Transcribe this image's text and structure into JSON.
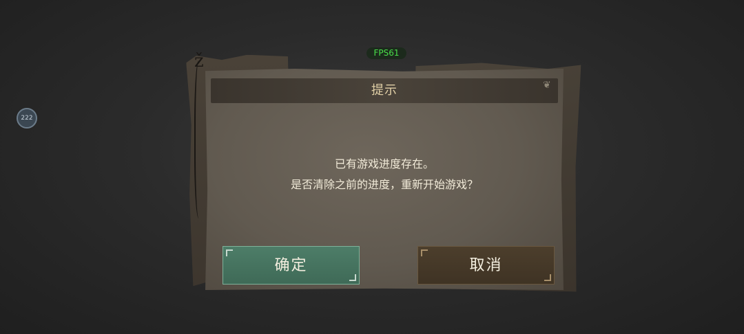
{
  "overlay": {
    "fps_label": "FPS61",
    "floating_ball_label": "222"
  },
  "dialog": {
    "title": "提示",
    "message_line1": "已有游戏进度存在。",
    "message_line2": "是否清除之前的进度，重新开始游戏？",
    "confirm_label": "确定",
    "cancel_label": "取消"
  },
  "colors": {
    "confirm_button": "#4d7d68",
    "cancel_button": "#4c3e2c",
    "title_text": "#e0cfa6",
    "fps_text": "#49e04a"
  },
  "icons": {
    "floating_ball": "assistive-touch-icon",
    "title_ornament": "scroll-ornament-icon"
  }
}
